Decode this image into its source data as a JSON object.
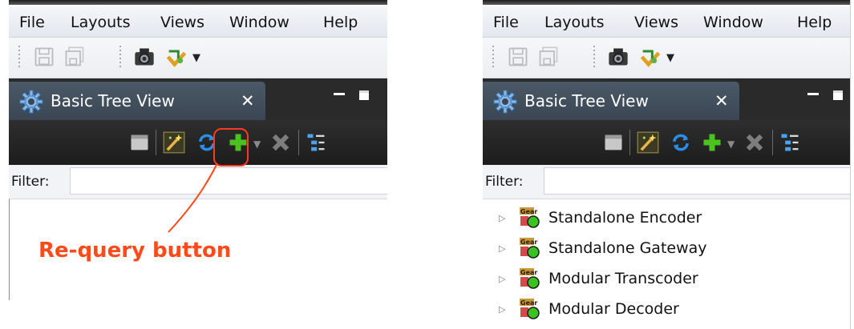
{
  "menu": [
    "File",
    "Layouts",
    "Views",
    "Window",
    "Help"
  ],
  "toolbar": {
    "icons": [
      "save-icon",
      "save-all-icon",
      "camera-icon",
      "layout-icon",
      "dropdown-arrow-icon"
    ]
  },
  "view": {
    "title": "Basic Tree View",
    "close_glyph": "✕",
    "toolbar_icons": [
      "panel-icon",
      "wand-icon",
      "refresh-icon",
      "add-icon",
      "dropdown-icon",
      "delete-icon",
      "tree-layout-icon"
    ]
  },
  "filter": {
    "label": "Filter:",
    "value": "",
    "placeholder": ""
  },
  "tree_items": [
    {
      "label": "Standalone Encoder",
      "icon": "gear-status-icon"
    },
    {
      "label": "Standalone Gateway",
      "icon": "gear-status-icon"
    },
    {
      "label": "Modular Transcoder",
      "icon": "gear-status-icon"
    },
    {
      "label": "Modular Decoder",
      "icon": "gear-status-icon"
    }
  ],
  "annotation": {
    "text": "Re-query button",
    "color": "#ff4a1a"
  },
  "colors": {
    "view_header": "#2a2a2a",
    "view_tab": "#4b5968",
    "accent_blue": "#2a8ee6",
    "add_green": "#4cc21e",
    "callout": "#ff3b1f"
  }
}
